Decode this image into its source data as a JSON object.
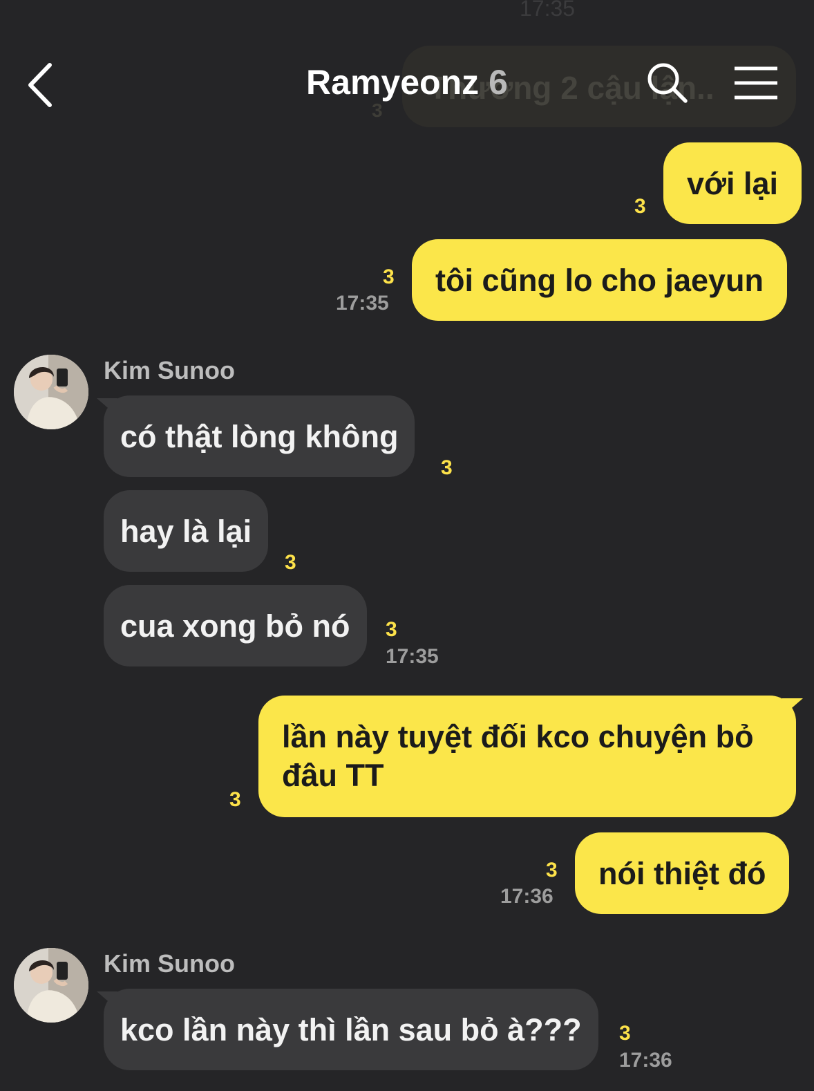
{
  "header": {
    "title": "Ramyeonz",
    "member_count": "6"
  },
  "background_ghost": {
    "time": "17:35",
    "text": "Thương 2 cậu lận..",
    "read": "3"
  },
  "messages": [
    {
      "sender": "me",
      "text": "với lại",
      "read": "3",
      "time": ""
    },
    {
      "sender": "me",
      "text": "tôi cũng lo cho jaeyun",
      "read": "3",
      "time": "17:35"
    },
    {
      "sender": "Kim Sunoo",
      "text": "có thật lòng không",
      "read": "3",
      "time": ""
    },
    {
      "sender": "Kim Sunoo",
      "text": "hay là lại",
      "read": "3",
      "time": ""
    },
    {
      "sender": "Kim Sunoo",
      "text": "cua xong bỏ nó",
      "read": "3",
      "time": "17:35"
    },
    {
      "sender": "me",
      "text": "lần này tuyệt đối kco chuyện bỏ đâu TT",
      "read": "3",
      "time": ""
    },
    {
      "sender": "me",
      "text": "nói thiệt đó",
      "read": "3",
      "time": "17:36"
    },
    {
      "sender": "Kim Sunoo",
      "text": "kco lần này thì lần sau bỏ à???",
      "read": "3",
      "time": "17:36"
    }
  ],
  "groups": [
    {
      "sender_name": "Kim Sunoo"
    },
    {
      "sender_name": "Kim Sunoo"
    }
  ],
  "colors": {
    "background": "#252527",
    "my_bubble": "#fbe64a",
    "their_bubble": "#3a3a3c",
    "read_count": "#fde24a"
  },
  "icons": [
    "back-arrow-icon",
    "search-icon",
    "menu-icon"
  ]
}
